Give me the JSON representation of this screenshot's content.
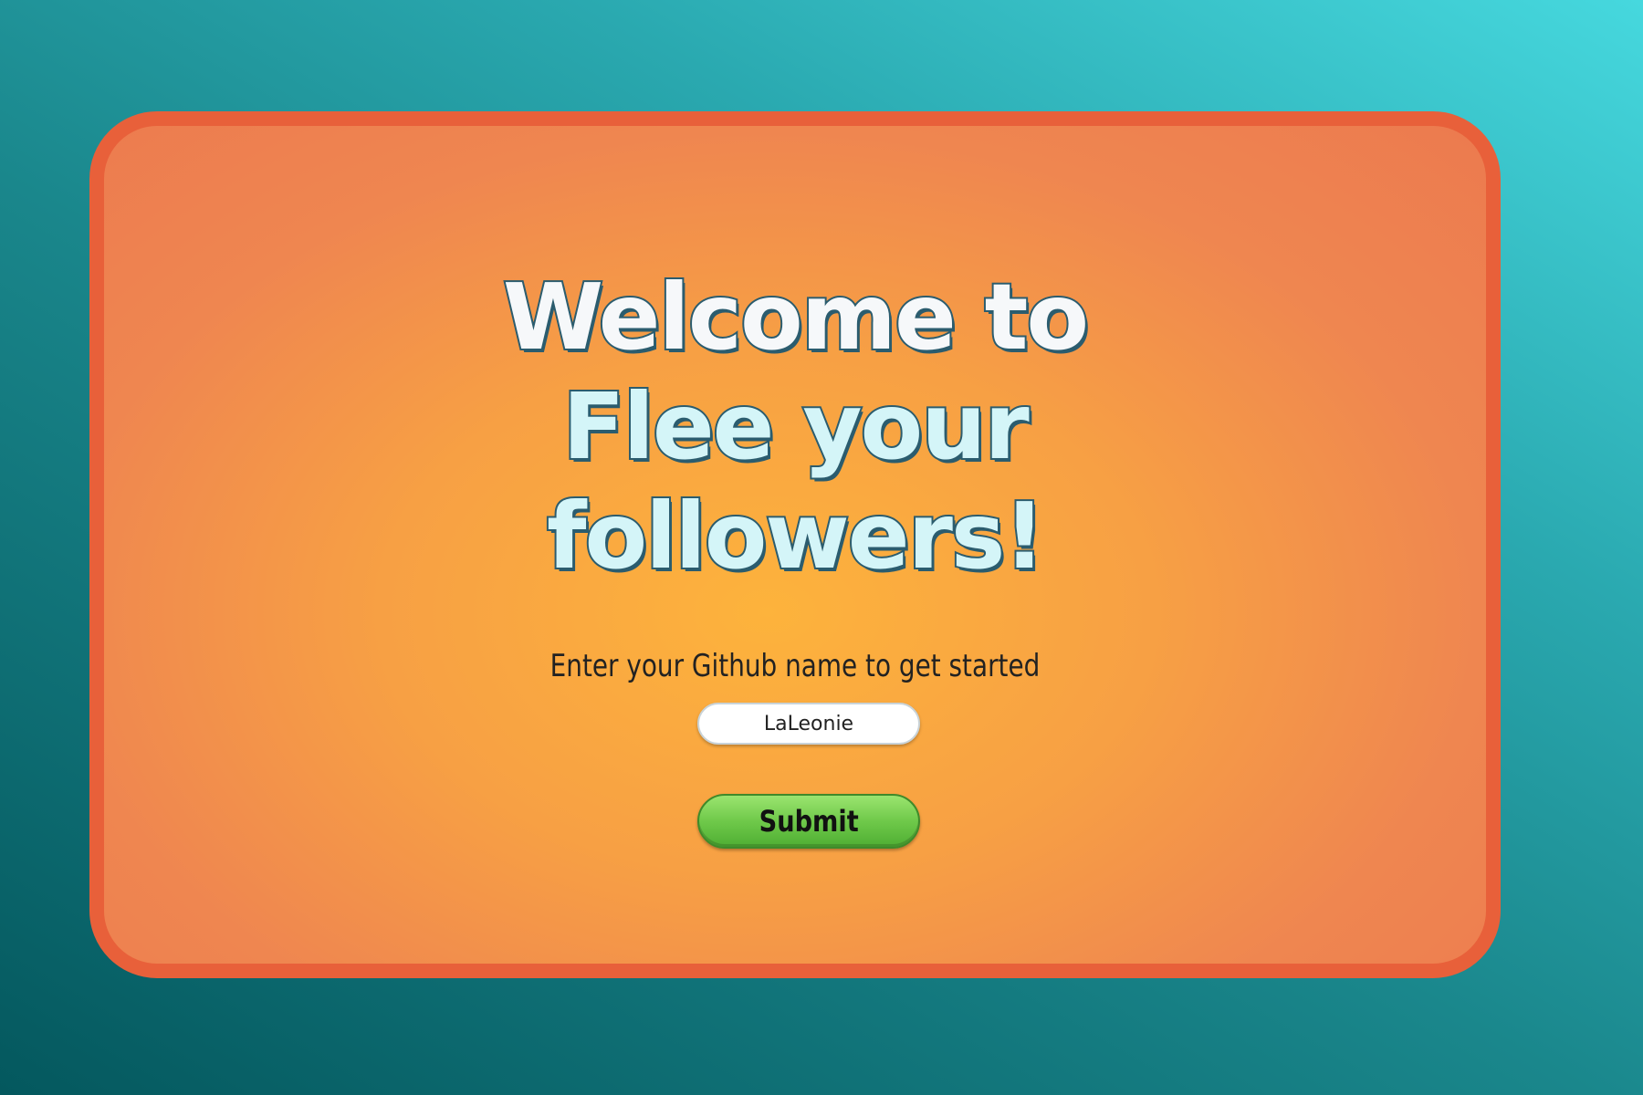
{
  "header": {
    "title_lines": [
      "Welcome to",
      "Flee your",
      "followers!"
    ]
  },
  "form": {
    "prompt": "Enter your Github name to get started",
    "username_value": "LaLeonie",
    "submit_label": "Submit"
  },
  "colors": {
    "background": "#1a878c",
    "card_fill": "#f7a044",
    "card_border": "#e8603a",
    "title_fill": "#f6f8fa",
    "title_accent": "#d4f5f8",
    "title_outline": "#2b5c6e",
    "button": "#6fc94a"
  }
}
